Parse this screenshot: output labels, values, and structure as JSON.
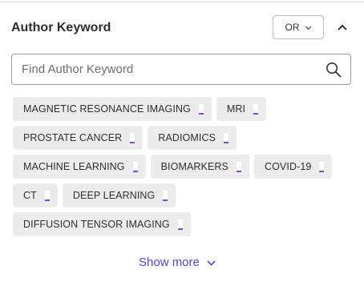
{
  "header": {
    "title": "Author Keyword",
    "operator": "OR"
  },
  "search": {
    "placeholder": "Find Author Keyword"
  },
  "keywords": [
    "MAGNETIC RESONANCE IMAGING",
    "MRI",
    "PROSTATE CANCER",
    "RADIOMICS",
    "MACHINE LEARNING",
    "BIOMARKERS",
    "COVID-19",
    "CT",
    "DEEP LEARNING",
    "DIFFUSION TENSOR IMAGING"
  ],
  "show_more": "Show more",
  "colors": {
    "accent": "#5a3fd0",
    "chip_bg": "#ececec",
    "chip_marker": "#8a3fd6"
  },
  "icons": {
    "operator_dropdown": "chevron-down-icon",
    "collapse": "chevron-up-icon",
    "search": "search-icon",
    "show_more": "chevron-down-icon"
  }
}
